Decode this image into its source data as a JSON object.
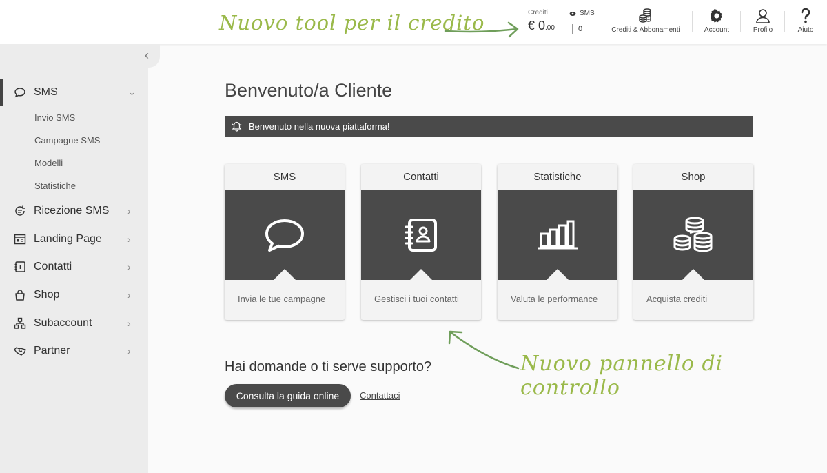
{
  "annotations": {
    "credit_tool": "Nuovo tool per il credito",
    "control_panel": "Nuovo pannello di controllo"
  },
  "header": {
    "credit_label": "Crediti",
    "credit_value": "€ 0",
    "credit_decimals": ".00",
    "sms_label": "SMS",
    "sms_value": "0",
    "actions": [
      {
        "label": "Crediti & Abbonamenti",
        "icon": "coins-icon"
      },
      {
        "label": "Account",
        "icon": "gear-icon"
      },
      {
        "label": "Profilo",
        "icon": "user-icon"
      },
      {
        "label": "Aiuto",
        "icon": "question-icon"
      }
    ]
  },
  "sidebar": {
    "items": [
      {
        "label": "SMS",
        "icon": "chat-bubble-icon",
        "expanded": true,
        "children": [
          "Invio SMS",
          "Campagne SMS",
          "Modelli",
          "Statistiche"
        ]
      },
      {
        "label": "Ricezione SMS",
        "icon": "refresh-chat-icon"
      },
      {
        "label": "Landing Page",
        "icon": "webpage-icon"
      },
      {
        "label": "Contatti",
        "icon": "address-book-icon"
      },
      {
        "label": "Shop",
        "icon": "shopping-bag-icon"
      },
      {
        "label": "Subaccount",
        "icon": "hierarchy-icon"
      },
      {
        "label": "Partner",
        "icon": "handshake-icon"
      }
    ]
  },
  "main": {
    "title": "Benvenuto/a Cliente",
    "banner": "Benvenuto nella nuova piattaforma!",
    "cards": [
      {
        "title": "SMS",
        "desc": "Invia le tue campagne",
        "icon": "chat-bubble-icon"
      },
      {
        "title": "Contatti",
        "desc": "Gestisci i tuoi contatti",
        "icon": "address-book-icon"
      },
      {
        "title": "Statistiche",
        "desc": "Valuta le performance",
        "icon": "bar-chart-icon"
      },
      {
        "title": "Shop",
        "desc": "Acquista crediti",
        "icon": "coins-stack-icon"
      }
    ],
    "support_question": "Hai domande o ti serve supporto?",
    "guide_button": "Consulta la guida online",
    "contact_link": "Contattaci"
  },
  "colors": {
    "accent_green": "#9ab94a",
    "dark_panel": "#4a4a4a",
    "sidebar_bg": "#ececec"
  }
}
